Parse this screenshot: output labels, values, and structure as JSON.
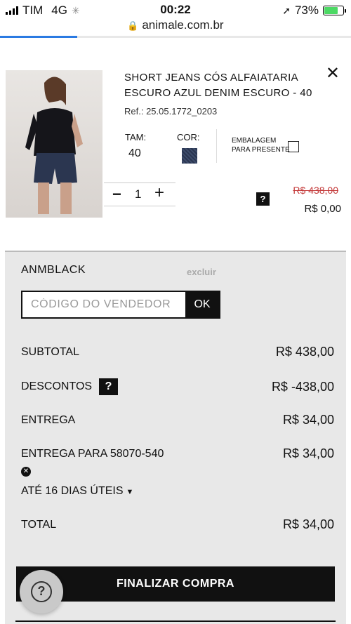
{
  "status": {
    "carrier": "TIM",
    "network": "4G",
    "time": "00:22",
    "battery": "73%",
    "battery_level": 0.73
  },
  "browser": {
    "url": "animale.com.br",
    "load_progress": 0.22
  },
  "product": {
    "title": "SHORT JEANS CÓS ALFAIATARIA ESCURO AZUL DENIM ESCURO - 40",
    "ref": "Ref.: 25.05.1772_0203",
    "size_label": "TAM:",
    "size_value": "40",
    "color_label": "COR:",
    "gift_wrap_label_1": "EMBALAGEM",
    "gift_wrap_label_2": "PARA PRESENTE",
    "quantity": "1",
    "old_price": "R$ 438,00",
    "price": "R$ 0,00"
  },
  "summary": {
    "coupon_code": "ANMBLACK",
    "remove_label": "excluir",
    "vendor_placeholder": "CÓDIGO DO VENDEDOR",
    "ok_label": "OK",
    "subtotal_label": "SUBTOTAL",
    "subtotal_value": "R$ 438,00",
    "discount_label": "DESCONTOS",
    "discount_value": "R$ -438,00",
    "delivery_label": "ENTREGA",
    "delivery_value": "R$ 34,00",
    "delivery_to_label": "ENTREGA PARA 58070-540",
    "delivery_to_value": "R$ 34,00",
    "delivery_time": "ATÉ 16 DIAS ÚTEIS",
    "total_label": "TOTAL",
    "total_value": "R$ 34,00",
    "checkout_label": "FINALIZAR COMPRA"
  }
}
